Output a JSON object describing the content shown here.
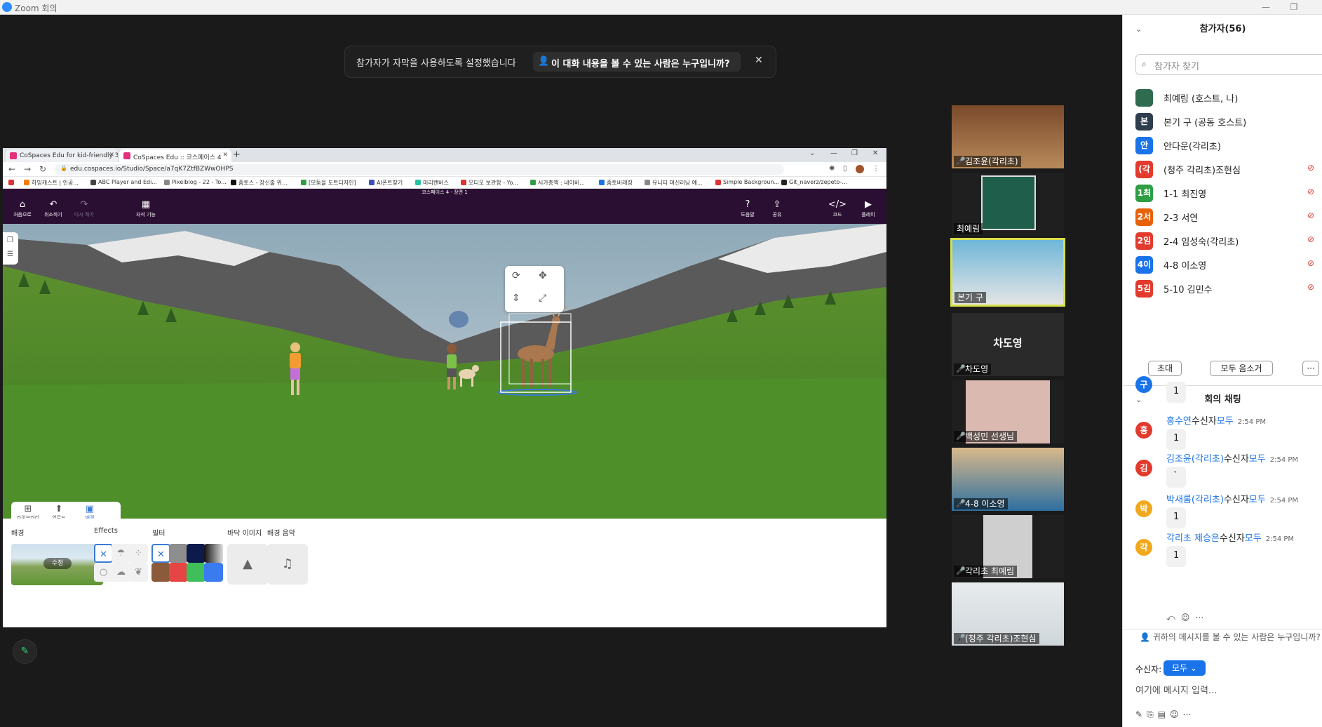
{
  "window": {
    "title": "Zoom 회의"
  },
  "banner": {
    "text": "참가자가 자막을 사용하도록 설정했습니다",
    "button": "이 대화 내용을 볼 수 있는 사람은 누구입니까?"
  },
  "browser": {
    "tabs": [
      {
        "label": "CoSpaces Edu for kid-friendly 3"
      },
      {
        "label": "CoSpaces Edu :: 코스페이스 4"
      }
    ],
    "url": "edu.cospaces.io/Studio/Space/a7qK7ZtfBZWwOHPS",
    "bookmarks": [
      "하밍캐스트 | 인공...",
      "ABC Player and Edi...",
      "Pixelblog - 22 - To...",
      "줌토스 - 장신출 위...",
      "[모둠을 도트디자인]",
      "AI폰트찾기",
      "미리캔버스",
      "오디오 보관함 - Yo...",
      "시가총액 : 네이버...",
      "줌토바레징",
      "유니티 머신러닝 예...",
      "Simple Backgroun...",
      "Git_naverz/zepeto-..."
    ]
  },
  "cospaces": {
    "scene_title": "코스페이스 4 - 장면 1",
    "toolbar": [
      {
        "label": "처음으로",
        "icon": "home-icon"
      },
      {
        "label": "취소하기",
        "icon": "undo-icon"
      },
      {
        "label": "다시 하기",
        "icon": "redo-icon"
      },
      {
        "label": "자석 기능",
        "icon": "grid-icon"
      },
      {
        "label": "도움말",
        "icon": "help-icon"
      },
      {
        "label": "공유",
        "icon": "share-icon"
      },
      {
        "label": "코드",
        "icon": "code-icon"
      },
      {
        "label": "플레이",
        "icon": "play-icon"
      }
    ],
    "lib_tabs": [
      {
        "label": "라이브러리"
      },
      {
        "label": "업로드"
      },
      {
        "label": "배경"
      }
    ],
    "bottom": {
      "background_label": "배경",
      "effects_label": "Effects",
      "filter_label": "필터",
      "floor_label": "바닥 이미지",
      "music_label": "배경 음악",
      "edit_label": "수정"
    }
  },
  "gallery": [
    {
      "name": "김조윤(각리초)"
    },
    {
      "name": "최예림"
    },
    {
      "name": "본기 구"
    },
    {
      "name": "차도영",
      "big": "차도영"
    },
    {
      "name": "백성민 선생님"
    },
    {
      "name": "4-8 이소영"
    },
    {
      "name": "각리초 최예림"
    },
    {
      "name": "(청주 각리초)조현심"
    }
  ],
  "participants": {
    "title": "참가자(56)",
    "search_placeholder": "참가자 찾기",
    "list": [
      {
        "avatar": "",
        "name": "최예림 (호스트, 나)",
        "color": "#2e6b4f"
      },
      {
        "avatar": "본",
        "name": "본기 구 (공동 호스트)",
        "color": "#2f3e4e"
      },
      {
        "avatar": "안",
        "name": "안다운(각리초)",
        "color": "#1a73e8"
      },
      {
        "avatar": "(각",
        "name": "(청주 각리초)조현심",
        "color": "#e23b2e"
      },
      {
        "avatar": "1최",
        "name": "1-1 최진영",
        "color": "#2e9e45"
      },
      {
        "avatar": "2서",
        "name": "2-3 서연",
        "color": "#e8620c"
      },
      {
        "avatar": "2임",
        "name": "2-4 임성숙(각리초)",
        "color": "#e23b2e"
      },
      {
        "avatar": "4이",
        "name": "4-8 이소영",
        "color": "#1a73e8"
      },
      {
        "avatar": "5김",
        "name": "5-10 김민수",
        "color": "#e23b2e"
      }
    ],
    "invite": "초대",
    "mute_all": "모두 음소거",
    "more": "···"
  },
  "chat": {
    "title": "회의 채팅",
    "messages": [
      {
        "avatar": "구",
        "color": "#1a73e8",
        "sender": "",
        "recipient": "",
        "time": "",
        "text": "1"
      },
      {
        "avatar": "홍",
        "color": "#e23b2e",
        "sender": "홍수연",
        "recipient": "수신자",
        "to": "모두",
        "time": "2:54 PM",
        "text": "1"
      },
      {
        "avatar": "김",
        "color": "#e23b2e",
        "sender": "김조윤(각리초)",
        "recipient": "수신자",
        "to": "모두",
        "time": "2:54 PM",
        "text": "`"
      },
      {
        "avatar": "박",
        "color": "#f2a81d",
        "sender": "박새롬(각리초)",
        "recipient": "수신자",
        "to": "모두",
        "time": "2:54 PM",
        "text": "1"
      },
      {
        "avatar": "각",
        "color": "#f2a81d",
        "sender": "각리초 제승은",
        "recipient": "수신자",
        "to": "모두",
        "time": "2:54 PM",
        "text": "1"
      }
    ],
    "privacy_note": "귀하의 메시지를 볼 수 있는 사람은 누구입니까?",
    "recipient_label": "수신자:",
    "recipient_value": "모두",
    "input_placeholder": "여기에 메시지 입력..."
  }
}
